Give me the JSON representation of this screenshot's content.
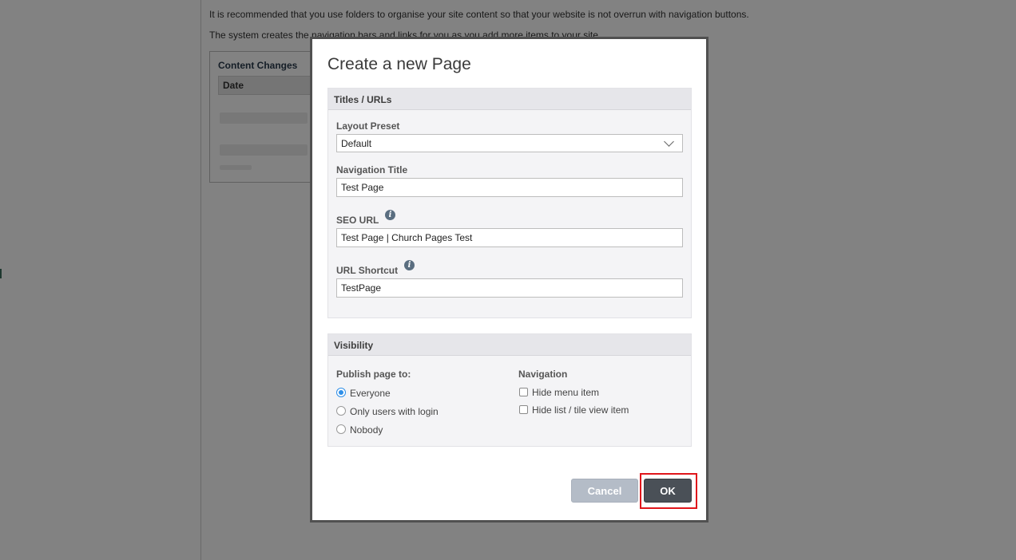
{
  "background": {
    "intro_line_1": "It is recommended that you use folders to organise your site content so that your website is not overrun with navigation buttons.",
    "intro_line_2": "The system creates the navigation bars and links for you as you add more items to your site.",
    "content_changes_title": "Content Changes",
    "date_header": "Date"
  },
  "dialog": {
    "title": "Create a new Page",
    "titles_section": {
      "heading": "Titles / URLs",
      "layout_preset_label": "Layout Preset",
      "layout_preset_value": "Default",
      "navigation_title_label": "Navigation Title",
      "navigation_title_value": "Test Page",
      "seo_url_label": "SEO URL",
      "seo_url_value": "Test Page | Church Pages Test",
      "url_shortcut_label": "URL Shortcut",
      "url_shortcut_value": "TestPage",
      "info_glyph": "i"
    },
    "visibility_section": {
      "heading": "Visibility",
      "publish_label": "Publish page to:",
      "publish_options": [
        "Everyone",
        "Only users with login",
        "Nobody"
      ],
      "publish_selected": "Everyone",
      "navigation_label": "Navigation",
      "navigation_options": [
        "Hide menu item",
        "Hide list / tile view item"
      ]
    },
    "buttons": {
      "cancel": "Cancel",
      "ok": "OK"
    }
  },
  "colors": {
    "overlay": "#000000",
    "ok_button": "#4a5057",
    "cancel_button": "#b4bcc7",
    "radio_selected": "#2f8fe8",
    "highlight": "#e0161b"
  },
  "icons": {
    "info": "info-icon",
    "select_chevron": "chevron-down-icon"
  }
}
